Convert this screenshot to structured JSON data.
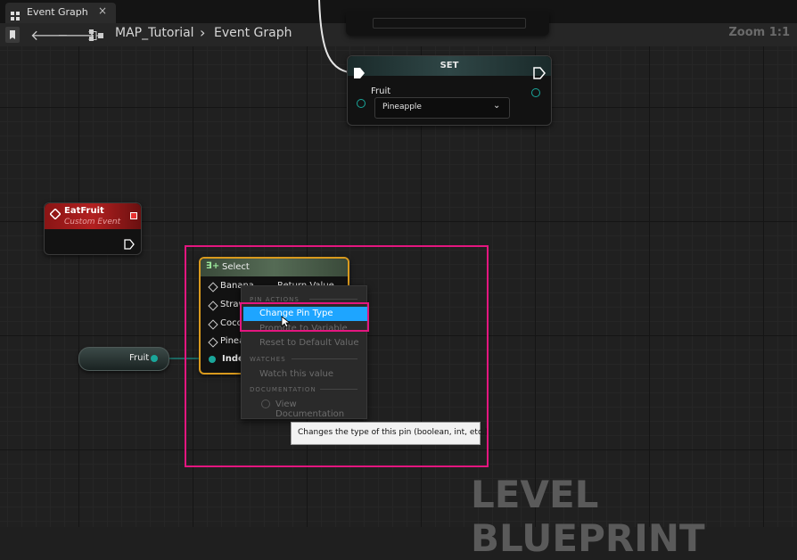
{
  "tab": {
    "label": "Event Graph",
    "close": "×"
  },
  "toolbar": {
    "crumb_root": "MAP_Tutorial",
    "crumb_sep": "›",
    "crumb_leaf": "Event Graph",
    "zoom": "Zoom 1:1"
  },
  "set_node": {
    "title": "SET",
    "var_label": "Fruit",
    "value": "Pineapple"
  },
  "event_node": {
    "title": "EatFruit",
    "subtitle": "Custom Event"
  },
  "fruit_var": {
    "label": "Fruit"
  },
  "select_node": {
    "title": "Select",
    "pins": [
      "Banana",
      "Straw",
      "Cocon",
      "Pinea",
      "Index"
    ],
    "return_label": "Return Value"
  },
  "context_menu": {
    "sections": {
      "pin_actions": "PIN ACTIONS",
      "watches": "WATCHES",
      "documentation": "DOCUMENTATION"
    },
    "items": {
      "change_pin_type": "Change Pin Type",
      "promote": "Promote to Variable",
      "reset": "Reset to Default Value",
      "watch": "Watch this value",
      "view_doc": "View Documentation"
    }
  },
  "tooltip": "Changes the type of this pin (boolean, int, etc.)",
  "watermark": "LEVEL BLUEPRINT",
  "colors": {
    "highlight": "#e3167f",
    "menu_selected": "#1ea5ff",
    "select_border": "#d99a1e",
    "event_red": "#a81a1a",
    "pin_teal": "#1aa69a"
  }
}
